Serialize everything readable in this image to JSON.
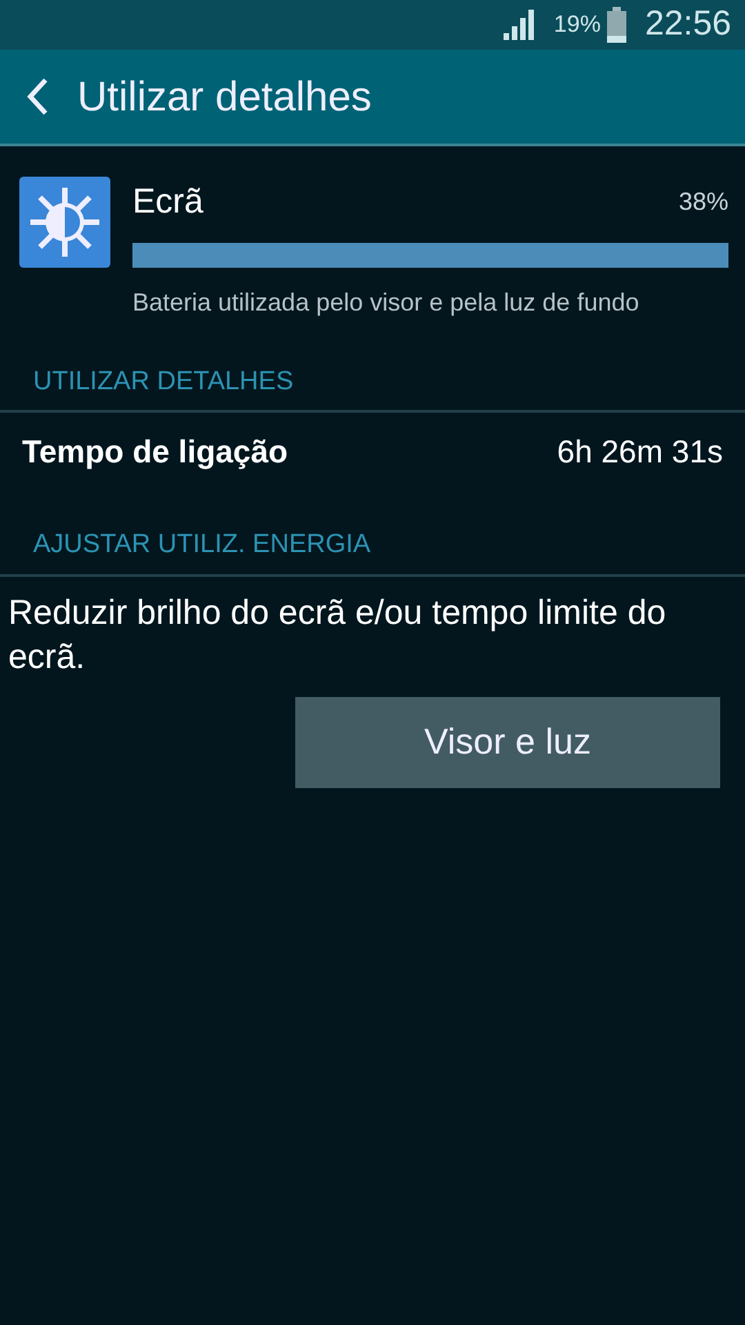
{
  "status_bar": {
    "battery_percent": "19%",
    "time": "22:56"
  },
  "app_bar": {
    "title": "Utilizar detalhes"
  },
  "usage_item": {
    "name": "Ecrã",
    "percent": "38%",
    "level": 1.0,
    "description": "Bateria utilizada pelo visor e pela luz de fundo"
  },
  "sections": [
    {
      "header": "UTILIZAR DETALHES",
      "rows": [
        {
          "label": "Tempo de ligação",
          "value": "6h 26m 31s"
        }
      ]
    },
    {
      "header": "AJUSTAR UTILIZ. ENERGIA",
      "text": "Reduzir brilho do ecrã e/ou tempo limite do ecrã.",
      "button": "Visor e luz"
    }
  ]
}
